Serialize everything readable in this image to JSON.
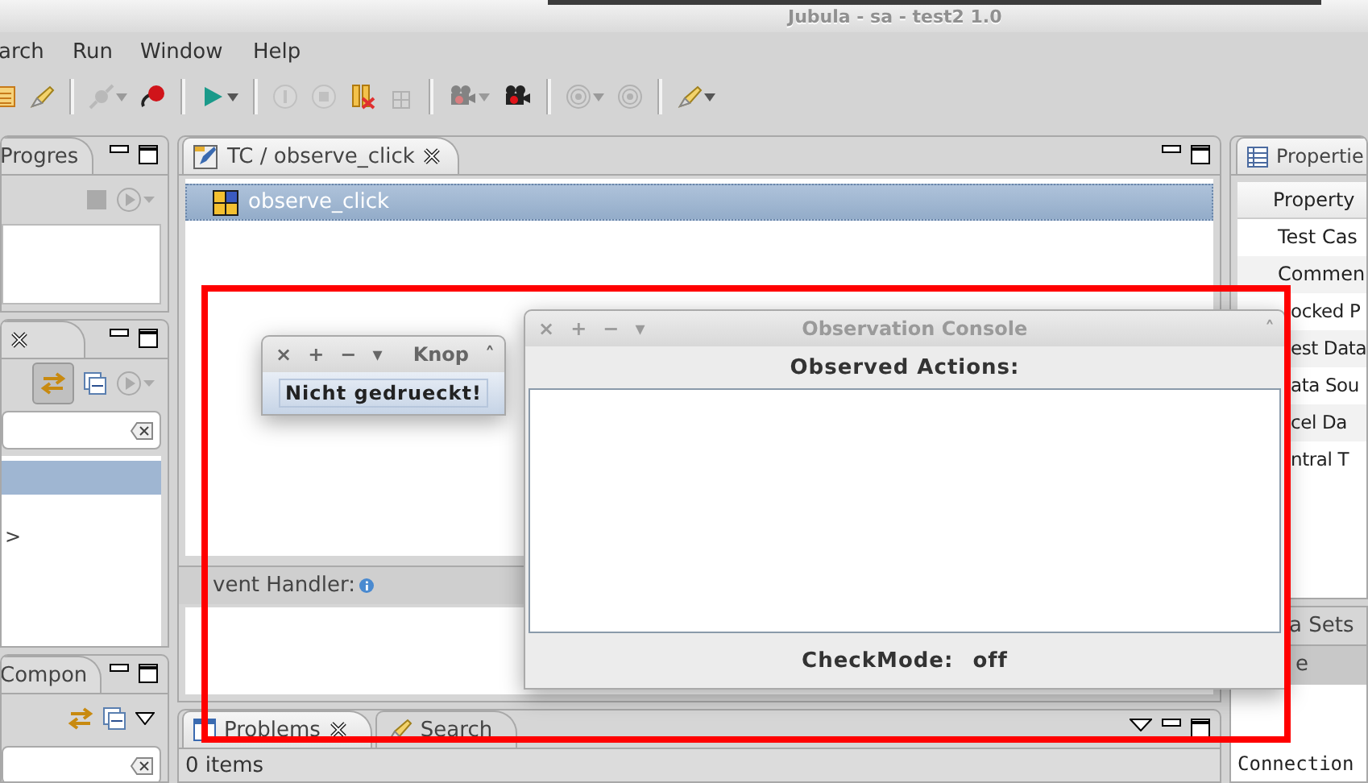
{
  "window": {
    "title": "Jubula - sa - test2 1.0"
  },
  "menu": [
    "arch",
    "Run",
    "Window",
    "Help"
  ],
  "toolbar": [
    {
      "kind": "table",
      "disabled": false,
      "caret": false
    },
    {
      "kind": "brush",
      "disabled": false,
      "caret": false
    },
    {
      "kind": "separator"
    },
    {
      "kind": "connector",
      "disabled": true,
      "caret": true
    },
    {
      "kind": "record",
      "disabled": false,
      "caret": false
    },
    {
      "kind": "separator"
    },
    {
      "kind": "play",
      "disabled": false,
      "caret": true
    },
    {
      "kind": "separator"
    },
    {
      "kind": "pause",
      "disabled": true,
      "caret": false
    },
    {
      "kind": "stop",
      "disabled": true,
      "caret": false
    },
    {
      "kind": "pause-cross",
      "disabled": false,
      "caret": false
    },
    {
      "kind": "grid",
      "disabled": true,
      "caret": false
    },
    {
      "kind": "separator"
    },
    {
      "kind": "camera",
      "disabled": true,
      "caret": true
    },
    {
      "kind": "camera",
      "disabled": false,
      "caret": false
    },
    {
      "kind": "separator"
    },
    {
      "kind": "target",
      "disabled": true,
      "caret": true
    },
    {
      "kind": "target",
      "disabled": true,
      "caret": false
    },
    {
      "kind": "separator"
    },
    {
      "kind": "brush",
      "disabled": false,
      "caret": true
    }
  ],
  "progress_view": {
    "tab": "Progres"
  },
  "navigator_view": {
    "rows": [
      {
        "selected": true
      },
      {
        "label": ">",
        "selected": false
      }
    ]
  },
  "components_view": {
    "tab": "Compon"
  },
  "editor": {
    "tab": "TC / observe_click",
    "tree": [
      {
        "label": "observe_click",
        "selected": true
      }
    ]
  },
  "event_handler": {
    "label": "vent Handler:"
  },
  "problems_view": {
    "tabs": [
      {
        "label": "Problems",
        "selected": true
      },
      {
        "label": "Search",
        "selected": false
      }
    ],
    "status": "0 items"
  },
  "properties_view": {
    "tab": "Propertie",
    "column": "Property",
    "rows": [
      "Test Cas",
      "Commen",
      "ocked P",
      "est Data",
      "ata Sou",
      "cel Da",
      "ntral T"
    ]
  },
  "data_sets_view": {
    "tab": "a Sets",
    "column": "e",
    "rows": [
      "Connection"
    ]
  },
  "knop_window": {
    "title": "Knop",
    "active": true,
    "controls": [
      "×",
      "+",
      "−",
      "▾"
    ],
    "collapse": "˄",
    "button": "Nicht gedrueckt!"
  },
  "observation_console": {
    "title": "Observation Console",
    "active": false,
    "controls": [
      "×",
      "+",
      "−",
      "▾"
    ],
    "collapse": "˄",
    "heading": "Observed Actions:",
    "footer_label": "CheckMode:",
    "footer_value": "off"
  }
}
